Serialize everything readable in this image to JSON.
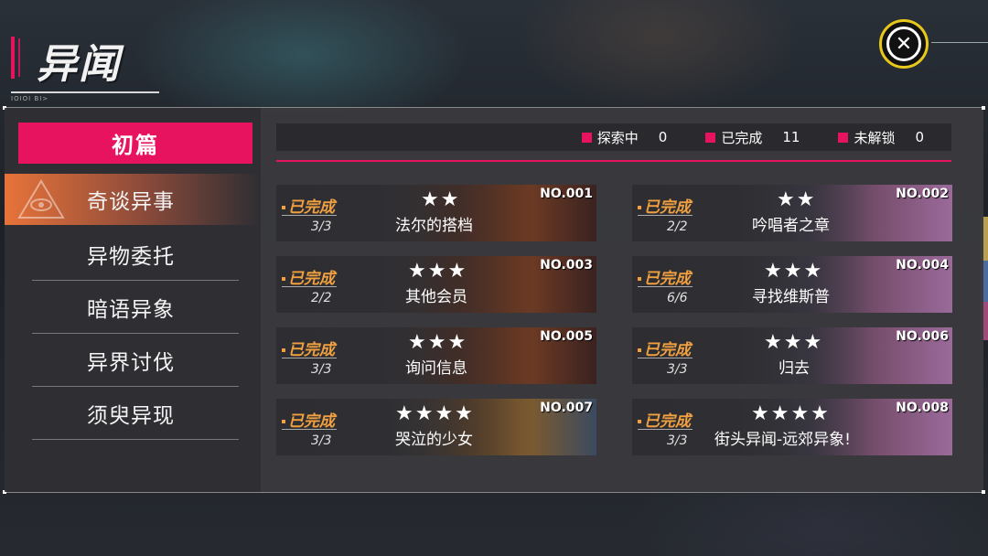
{
  "header": {
    "title": "异闻",
    "subtitle": "IOIOI BI>"
  },
  "close_button": {
    "icon": "close-x-icon",
    "glyph": "✕"
  },
  "chapter": {
    "label": "初篇"
  },
  "categories": [
    {
      "label": "奇谈异事",
      "active": true
    },
    {
      "label": "异物委托",
      "active": false
    },
    {
      "label": "暗语异象",
      "active": false
    },
    {
      "label": "异界讨伐",
      "active": false
    },
    {
      "label": "须臾异现",
      "active": false
    }
  ],
  "status": {
    "exploring": {
      "label": "探索中",
      "value": "0"
    },
    "completed": {
      "label": "已完成",
      "value": "11"
    },
    "locked": {
      "label": "未解锁",
      "value": "0"
    }
  },
  "colors": {
    "accent": "#e8135f",
    "done": "#f0a040",
    "close_ring": "#e8c81a"
  },
  "cards": [
    {
      "no": "NO.001",
      "status": "已完成",
      "progress": "3/3",
      "stars": "★★",
      "title": "法尔的搭档"
    },
    {
      "no": "NO.002",
      "status": "已完成",
      "progress": "2/2",
      "stars": "★★",
      "title": "吟唱者之章"
    },
    {
      "no": "NO.003",
      "status": "已完成",
      "progress": "2/2",
      "stars": "★★★",
      "title": "其他会员"
    },
    {
      "no": "NO.004",
      "status": "已完成",
      "progress": "6/6",
      "stars": "★★★",
      "title": "寻找维斯普"
    },
    {
      "no": "NO.005",
      "status": "已完成",
      "progress": "3/3",
      "stars": "★★★",
      "title": "询问信息"
    },
    {
      "no": "NO.006",
      "status": "已完成",
      "progress": "3/3",
      "stars": "★★★",
      "title": "归去"
    },
    {
      "no": "NO.007",
      "status": "已完成",
      "progress": "3/3",
      "stars": "★★★★",
      "title": "哭泣的少女"
    },
    {
      "no": "NO.008",
      "status": "已完成",
      "progress": "3/3",
      "stars": "★★★★",
      "title": "街头异闻-远郊异象!"
    }
  ]
}
